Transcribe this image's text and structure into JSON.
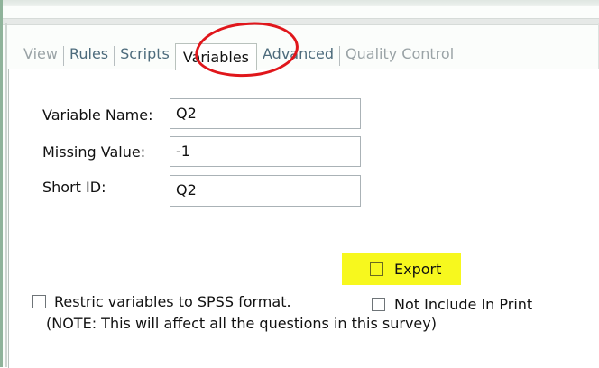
{
  "tabs": [
    {
      "label": "View",
      "state": "disabled"
    },
    {
      "label": "Rules",
      "state": "normal"
    },
    {
      "label": "Scripts",
      "state": "normal"
    },
    {
      "label": "Variables",
      "state": "active"
    },
    {
      "label": "Advanced",
      "state": "normal"
    },
    {
      "label": "Quality Control",
      "state": "disabled"
    }
  ],
  "form": {
    "variable_name_label": "Variable Name:",
    "variable_name_value": "Q2",
    "missing_value_label": "Missing Value:",
    "missing_value_value": "-1",
    "short_id_label": "Short ID:",
    "short_id_value": "Q2"
  },
  "options": {
    "export_label": "Export",
    "export_checked": false,
    "not_include_label": "Not Include In Print",
    "not_include_checked": false,
    "restrict_label": "Restric variables to SPSS format.",
    "restrict_checked": false,
    "restrict_note": "(NOTE: This will affect all the questions in this survey)"
  },
  "colors": {
    "annotation_circle": "#e0161b",
    "annotation_highlight": "#f7f81e",
    "tab_text": "#4d6b7c",
    "tab_disabled": "#9aa3a6"
  }
}
